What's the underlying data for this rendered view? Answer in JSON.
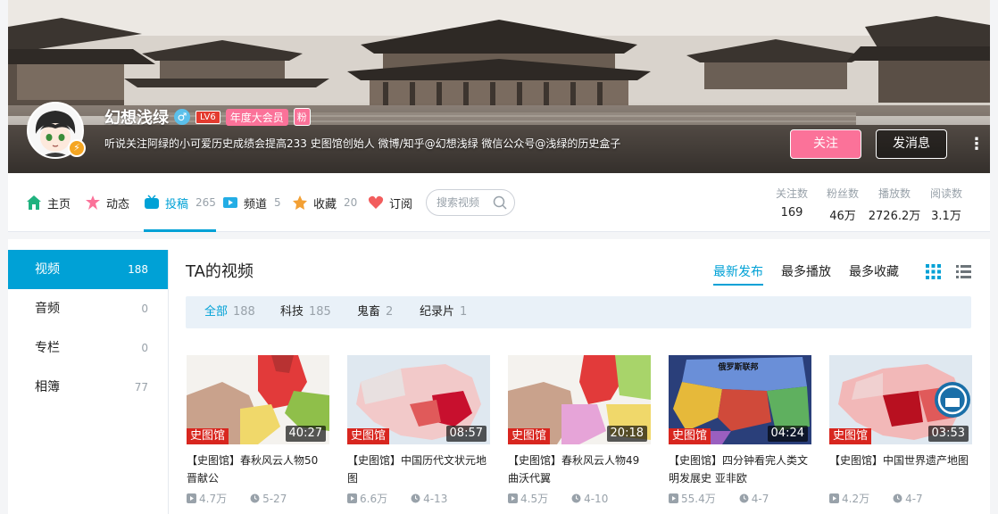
{
  "profile": {
    "username": "幻想浅绿",
    "gender_symbol": "♂",
    "level": "LV6",
    "vip_label": "年度大会员",
    "fan_badge": "粉",
    "sign": "听说关注阿绿的小可爱历史成绩会提高233 史图馆创始人 微博/知乎@幻想浅绿 微信公众号@浅绿的历史盒子",
    "avatar_badge": "⚡",
    "follow_label": "关注",
    "message_label": "发消息",
    "more_label": "⋮"
  },
  "nav": {
    "items": [
      {
        "label": "主页",
        "count": "",
        "icon": "home-icon"
      },
      {
        "label": "动态",
        "count": "",
        "icon": "dynamic-icon"
      },
      {
        "label": "投稿",
        "count": "265",
        "icon": "upload-icon"
      },
      {
        "label": "频道",
        "count": "5",
        "icon": "channel-icon"
      },
      {
        "label": "收藏",
        "count": "20",
        "icon": "favorite-icon"
      },
      {
        "label": "订阅",
        "count": "",
        "icon": "subscribe-icon"
      }
    ],
    "search_placeholder": "搜索视频"
  },
  "stats": [
    {
      "label": "关注数",
      "value": "169"
    },
    {
      "label": "粉丝数",
      "value": "46万"
    },
    {
      "label": "播放数",
      "value": "2726.2万"
    },
    {
      "label": "阅读数",
      "value": "3.1万"
    }
  ],
  "sidebar": {
    "items": [
      {
        "label": "视频",
        "count": "188"
      },
      {
        "label": "音频",
        "count": "0"
      },
      {
        "label": "专栏",
        "count": "0"
      },
      {
        "label": "相簿",
        "count": "77"
      }
    ]
  },
  "content": {
    "title": "TA的视频",
    "sort_options": [
      "最新发布",
      "最多播放",
      "最多收藏"
    ],
    "filters": [
      {
        "label": "全部",
        "count": "188"
      },
      {
        "label": "科技",
        "count": "185"
      },
      {
        "label": "鬼畜",
        "count": "2"
      },
      {
        "label": "纪录片",
        "count": "1"
      }
    ],
    "videos": [
      {
        "title": "【史图馆】春秋风云人物50 晋献公",
        "duration": "40:27",
        "plays": "4.7万",
        "date": "5-27",
        "watermark": "史图馆"
      },
      {
        "title": "【史图馆】中国历代文状元地图",
        "duration": "08:57",
        "plays": "6.6万",
        "date": "4-13",
        "watermark": "史图馆"
      },
      {
        "title": "【史图馆】春秋风云人物49 曲沃代翼",
        "duration": "20:18",
        "plays": "4.5万",
        "date": "4-10",
        "watermark": "史图馆"
      },
      {
        "title": "【史图馆】四分钟看完人类文明发展史 亚非欧",
        "duration": "04:24",
        "plays": "55.4万",
        "date": "4-7",
        "watermark": "史图馆",
        "map_label": "俄罗斯联邦"
      },
      {
        "title": "【史图馆】中国世界遗产地图",
        "duration": "03:53",
        "plays": "4.2万",
        "date": "4-7",
        "watermark": "史图馆"
      }
    ]
  },
  "colors": {
    "accent": "#00a1d6",
    "pink": "#fb7299"
  }
}
